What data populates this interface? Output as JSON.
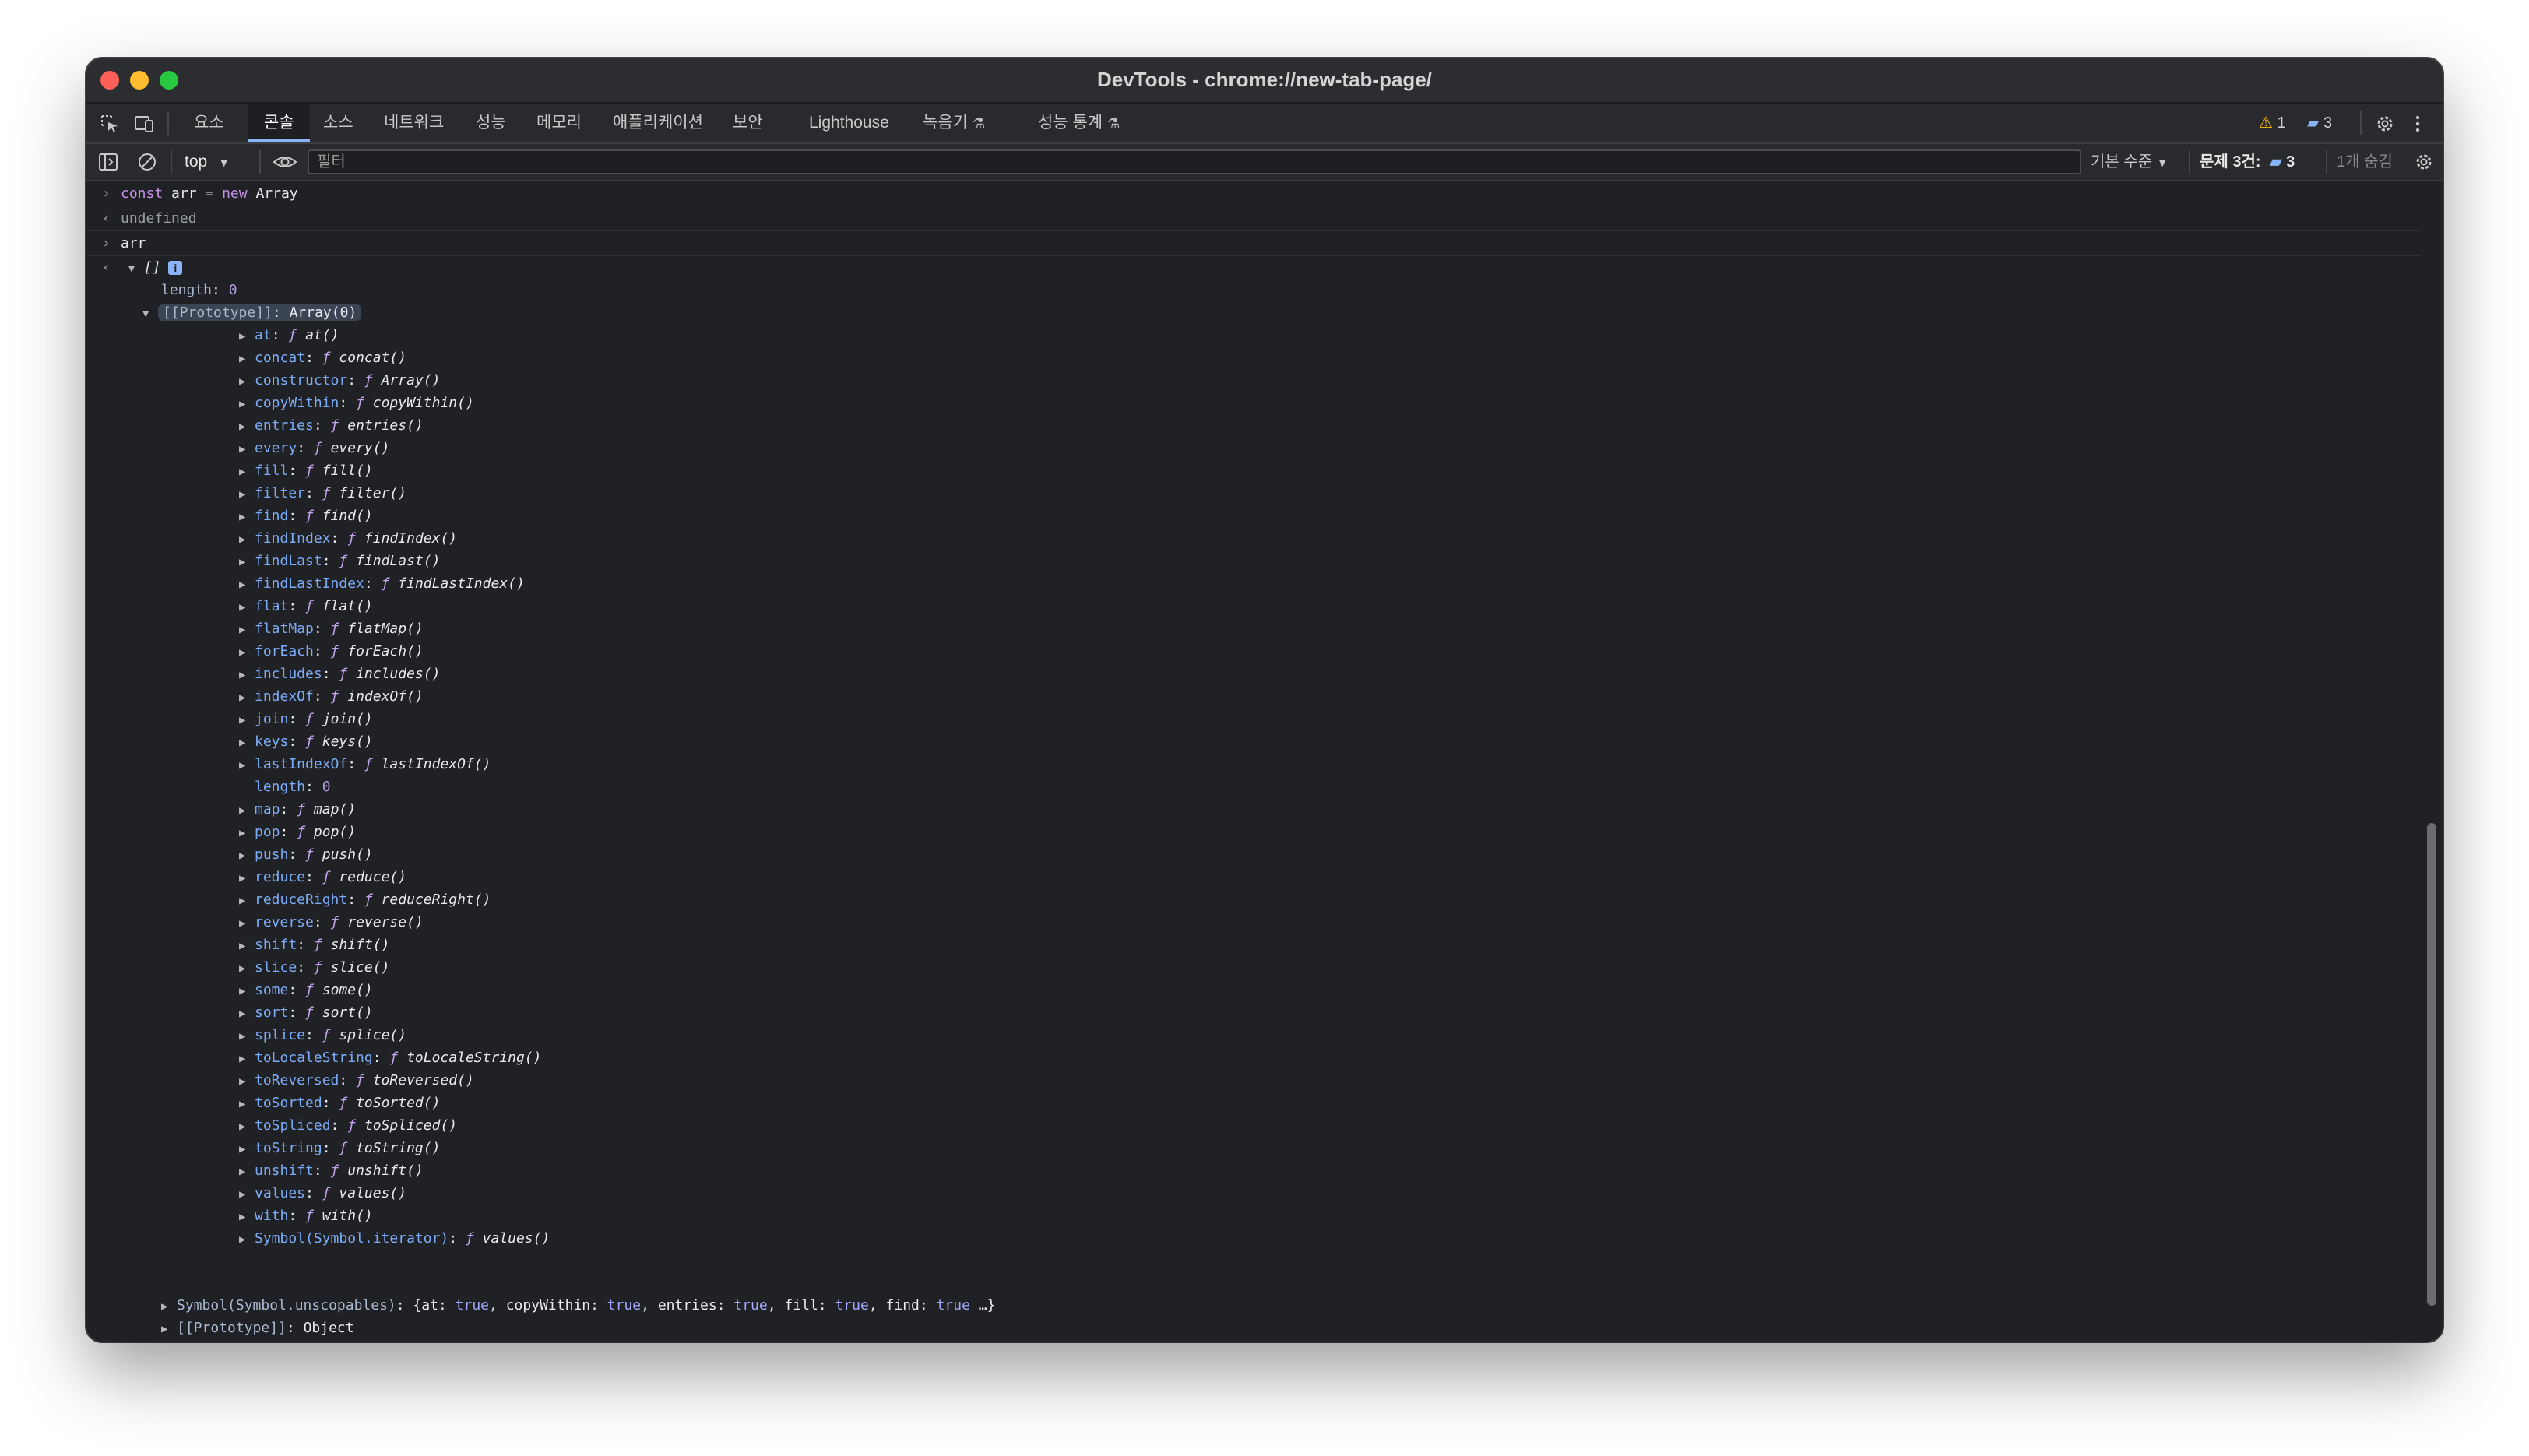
{
  "window": {
    "title": "DevTools - chrome://new-tab-page/"
  },
  "tabs": [
    {
      "label": "요소"
    },
    {
      "label": "콘솔",
      "active": true
    },
    {
      "label": "소스"
    },
    {
      "label": "네트워크"
    },
    {
      "label": "성능"
    },
    {
      "label": "메모리"
    },
    {
      "label": "애플리케이션"
    },
    {
      "label": "보안"
    },
    {
      "label": "Lighthouse"
    },
    {
      "label": "녹음기"
    },
    {
      "label": "성능 통계"
    }
  ],
  "header_right": {
    "warnings_count": "1",
    "messages_count": "3"
  },
  "toolbar": {
    "context": "top",
    "filter_placeholder": "필터",
    "levels_label": "기본 수준",
    "issues_label": "문제 3건:",
    "issues_count": "3",
    "hidden_label": "1개 숨김"
  },
  "console": {
    "entries": [
      {
        "type": "input",
        "kw": "const",
        "name": "arr",
        "op": "=",
        "kw2": "new",
        "cls": "Array"
      },
      {
        "type": "output",
        "text": "undefined"
      },
      {
        "type": "input",
        "text": "arr"
      }
    ],
    "array_summary": "[]",
    "array_info_badge": "i",
    "length_key": "length",
    "length_value": "0",
    "prototype_key": "[[Prototype]]",
    "prototype_value": "Array(0)",
    "f_symbol": "ƒ",
    "methods": [
      {
        "name": "at",
        "fn": "at()"
      },
      {
        "name": "concat",
        "fn": "concat()"
      },
      {
        "name": "constructor",
        "fn": "Array()"
      },
      {
        "name": "copyWithin",
        "fn": "copyWithin()"
      },
      {
        "name": "entries",
        "fn": "entries()"
      },
      {
        "name": "every",
        "fn": "every()"
      },
      {
        "name": "fill",
        "fn": "fill()"
      },
      {
        "name": "filter",
        "fn": "filter()"
      },
      {
        "name": "find",
        "fn": "find()"
      },
      {
        "name": "findIndex",
        "fn": "findIndex()"
      },
      {
        "name": "findLast",
        "fn": "findLast()"
      },
      {
        "name": "findLastIndex",
        "fn": "findLastIndex()"
      },
      {
        "name": "flat",
        "fn": "flat()"
      },
      {
        "name": "flatMap",
        "fn": "flatMap()"
      },
      {
        "name": "forEach",
        "fn": "forEach()"
      },
      {
        "name": "includes",
        "fn": "includes()"
      },
      {
        "name": "indexOf",
        "fn": "indexOf()"
      },
      {
        "name": "join",
        "fn": "join()"
      },
      {
        "name": "keys",
        "fn": "keys()"
      },
      {
        "name": "lastIndexOf",
        "fn": "lastIndexOf()"
      },
      {
        "name": "length",
        "value": "0"
      },
      {
        "name": "map",
        "fn": "map()"
      },
      {
        "name": "pop",
        "fn": "pop()"
      },
      {
        "name": "push",
        "fn": "push()"
      },
      {
        "name": "reduce",
        "fn": "reduce()"
      },
      {
        "name": "reduceRight",
        "fn": "reduceRight()"
      },
      {
        "name": "reverse",
        "fn": "reverse()"
      },
      {
        "name": "shift",
        "fn": "shift()"
      },
      {
        "name": "slice",
        "fn": "slice()"
      },
      {
        "name": "some",
        "fn": "some()"
      },
      {
        "name": "sort",
        "fn": "sort()"
      },
      {
        "name": "splice",
        "fn": "splice()"
      },
      {
        "name": "toLocaleString",
        "fn": "toLocaleString()"
      },
      {
        "name": "toReversed",
        "fn": "toReversed()"
      },
      {
        "name": "toSorted",
        "fn": "toSorted()"
      },
      {
        "name": "toSpliced",
        "fn": "toSpliced()"
      },
      {
        "name": "toString",
        "fn": "toString()"
      },
      {
        "name": "unshift",
        "fn": "unshift()"
      },
      {
        "name": "values",
        "fn": "values()"
      },
      {
        "name": "with",
        "fn": "with()"
      },
      {
        "name": "Symbol(Symbol.iterator)",
        "fn": "values()",
        "highlighted": true
      }
    ],
    "unscopables": {
      "key": "Symbol(Symbol.unscopables)",
      "open": "{",
      "pairs": [
        {
          "k": "at",
          "v": "true"
        },
        {
          "k": "copyWithin",
          "v": "true"
        },
        {
          "k": "entries",
          "v": "true"
        },
        {
          "k": "fill",
          "v": "true"
        },
        {
          "k": "find",
          "v": "true"
        }
      ],
      "ellipsis": "…}"
    },
    "object_prototype": {
      "key": "[[Prototype]]",
      "value": "Object"
    },
    "highlight_color": "#e5372a"
  }
}
